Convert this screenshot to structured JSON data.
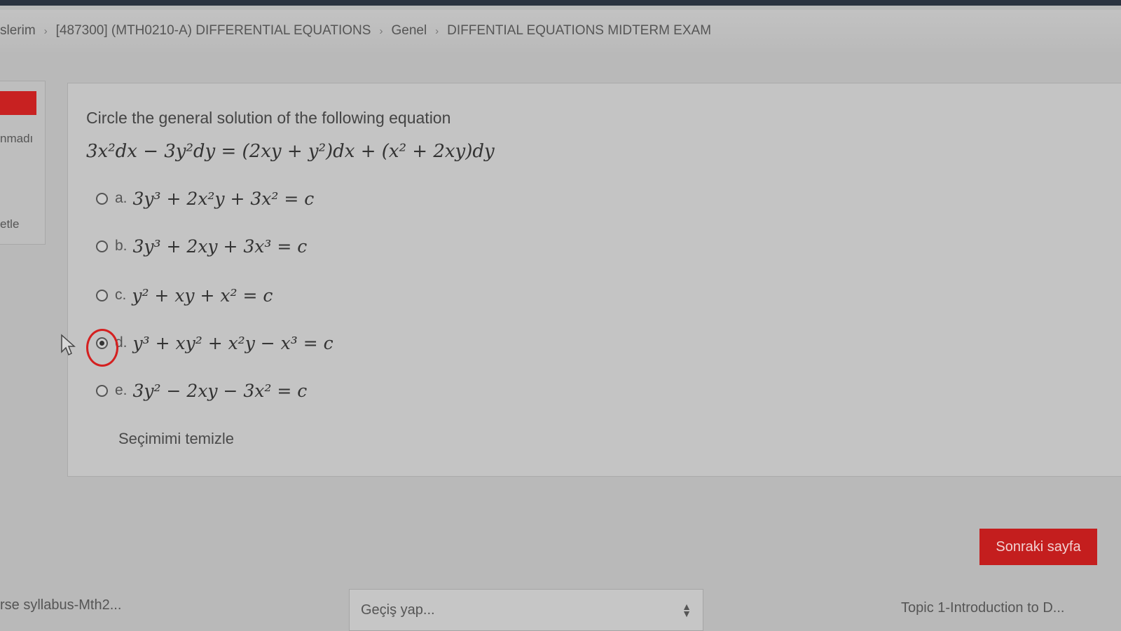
{
  "breadcrumb": {
    "items": [
      "slerim",
      "[487300] (MTH0210-A) DIFFERENTIAL EQUATIONS",
      "Genel",
      "DIFFENTIAL EQUATIONS MIDTERM EXAM"
    ]
  },
  "side": {
    "status_text": "nmadı",
    "flag_text": "etle"
  },
  "question": {
    "prompt": "Circle the general solution of the following equation",
    "equation": "3x²dx − 3y²dy = (2xy + y²)dx + (x² + 2xy)dy"
  },
  "options": [
    {
      "letter": "a.",
      "math": "3y³ + 2x²y + 3x² = c",
      "selected": false
    },
    {
      "letter": "b.",
      "math": "3y³ + 2xy + 3x³ = c",
      "selected": false
    },
    {
      "letter": "c.",
      "math": "y² + xy + x² = c",
      "selected": false
    },
    {
      "letter": "d.",
      "math": "y³ + xy² + x²y − x³ = c",
      "selected": true
    },
    {
      "letter": "e.",
      "math": "3y² − 2xy − 3x² = c",
      "selected": false
    }
  ],
  "clear_label": "Seçimimi temizle",
  "next_button": "Sonraki sayfa",
  "footer": {
    "prev_link": "rse syllabus-Mth2...",
    "jump_placeholder": "Geçiş yap...",
    "next_link": "Topic 1-Introduction to D..."
  },
  "colors": {
    "accent": "#c41e1e",
    "annotation": "#d42020"
  }
}
